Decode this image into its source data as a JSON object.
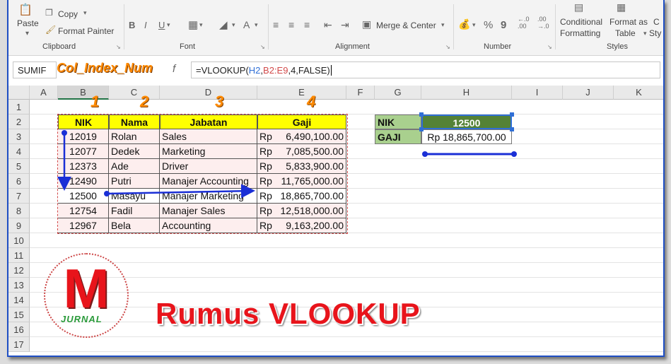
{
  "ribbon": {
    "paste_label": "Paste",
    "copy_label": "Copy",
    "format_painter_label": "Format Painter",
    "merge_center_label": "Merge & Center",
    "percent_symbol": "%",
    "comma_symbol": "9",
    "conditional_line1": "Conditional",
    "conditional_line2": "Formatting",
    "format_table_line1": "Format as",
    "format_table_line2": "Table",
    "cell_styles_line1": "C",
    "cell_styles_line2": "Sty",
    "groups": {
      "clipboard": "Clipboard",
      "font": "Font",
      "alignment": "Alignment",
      "number": "Number",
      "styles": "Styles"
    }
  },
  "formula_bar": {
    "name_box": "SUMIF",
    "fx": "f",
    "formula_prefix": "=VLOOKUP(",
    "formula_h2": "H2",
    "formula_comma1": ",",
    "formula_range": "B2:E9",
    "formula_suffix": ",4,FALSE)",
    "annotation": "Col_Index_Num"
  },
  "grid": {
    "columns": [
      "A",
      "B",
      "C",
      "D",
      "E",
      "F",
      "G",
      "H",
      "I",
      "J",
      "K"
    ],
    "rows": [
      "1",
      "2",
      "3",
      "4",
      "5",
      "6",
      "7",
      "8",
      "9",
      "10",
      "11",
      "12",
      "13",
      "14",
      "15",
      "16",
      "17"
    ],
    "headers": {
      "nik": "NIK",
      "nama": "Nama",
      "jabatan": "Jabatan",
      "gaji": "Gaji"
    },
    "data": [
      {
        "nik": "12019",
        "nama": "Rolan",
        "jabatan": "Sales",
        "rp": "Rp",
        "gaji": "6,490,100.00"
      },
      {
        "nik": "12077",
        "nama": "Dedek",
        "jabatan": "Marketing",
        "rp": "Rp",
        "gaji": "7,085,500.00"
      },
      {
        "nik": "12373",
        "nama": "Ade",
        "jabatan": "Driver",
        "rp": "Rp",
        "gaji": "5,833,900.00"
      },
      {
        "nik": "12490",
        "nama": "Putri",
        "jabatan": "Manajer Accounting",
        "rp": "Rp",
        "gaji": "11,765,000.00"
      },
      {
        "nik": "12500",
        "nama": "Masayu",
        "jabatan": "Manajer Marketing",
        "rp": "Rp",
        "gaji": "18,865,700.00"
      },
      {
        "nik": "12754",
        "nama": "Fadil",
        "jabatan": "Manajer Sales",
        "rp": "Rp",
        "gaji": "12,518,000.00"
      },
      {
        "nik": "12967",
        "nama": "Bela",
        "jabatan": "Accounting",
        "rp": "Rp",
        "gaji": "9,163,200.00"
      }
    ],
    "lookup": {
      "nik_label": "NIK",
      "nik_value": "12500",
      "gaji_label": "GAJI",
      "gaji_value": "Rp 18,865,700.00"
    },
    "column_numbers": [
      "1",
      "2",
      "3",
      "4"
    ]
  },
  "overlay": {
    "title": "Rumus VLOOKUP",
    "logo_letter": "M",
    "logo_word": "JURNAL"
  },
  "colors": {
    "header_yellow": "#ffff00",
    "lookup_green_label": "#a9d08e",
    "lookup_green_value": "#548235",
    "table_pink": "#fdeeee",
    "title_red": "#e8141b",
    "annotation_orange": "#ff8a00",
    "arrow_blue": "#1a2fd6"
  }
}
